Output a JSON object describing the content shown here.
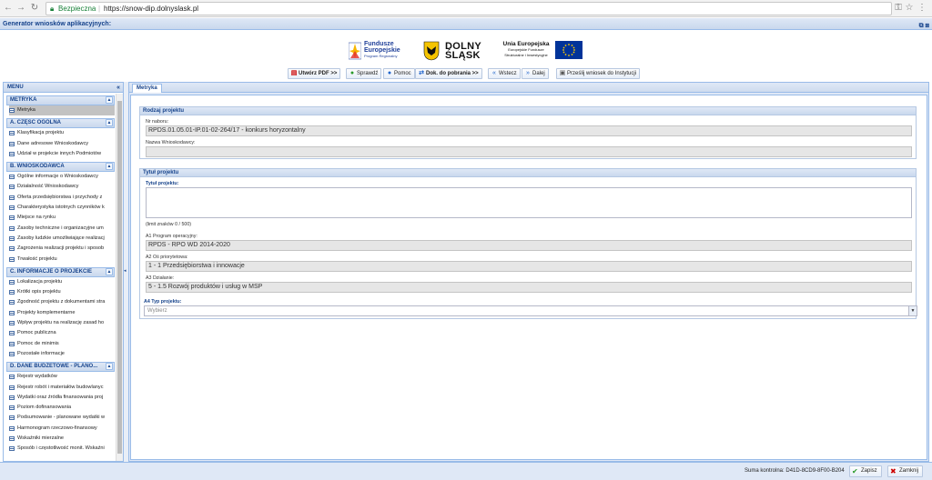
{
  "browser": {
    "secure_label": "Bezpieczna",
    "url": "https://snow-dip.dolnyslask.pl"
  },
  "app": {
    "title": "Generator wniosków aplikacyjnych:"
  },
  "logos": {
    "fe_line1": "Fundusze",
    "fe_line2": "Europejskie",
    "fe_line3": "Program Regionalny",
    "ds_line1": "DOLNY",
    "ds_line2": "ŚLĄSK",
    "ue_line1": "Unia Europejska",
    "ue_line2": "Europejskie Fundusze",
    "ue_line3": "Strukturalne i Inwestycyjne"
  },
  "toolbar": [
    {
      "label": "Utwórz PDF >>",
      "icon": "pdf-icon"
    },
    {
      "label": "Sprawdź",
      "icon": "check-icon"
    },
    {
      "label": "Pomoc",
      "icon": "help-icon"
    },
    {
      "label": "Dok. do pobrania >>",
      "icon": "download-icon"
    },
    {
      "label": "Wstecz",
      "icon": "back-icon"
    },
    {
      "label": "Dalej",
      "icon": "forward-icon"
    },
    {
      "label": "Prześlij wniosek do Instytucji",
      "icon": "send-icon"
    }
  ],
  "sidebar": {
    "title": "MENU",
    "sections": [
      {
        "title": "METRYKA",
        "items": [
          "Metryka"
        ]
      },
      {
        "title": "A. CZĘŚĆ OGÓLNA",
        "items": [
          "Klasyfikacja projektu",
          "Dane adresowe Wnioskodawcy",
          "Udział w projekcie innych Podmiotów"
        ]
      },
      {
        "title": "B. WNIOSKODAWCA",
        "items": [
          "Ogólne informacje o Wnioskodawcy",
          "Działalność Wnioskodawcy",
          "Oferta przedsiębiorstwa i przychody z",
          "Charakterystyka istotnych czynników k",
          "Miejsce na rynku",
          "Zasoby techniczne i organizacyjne um",
          "Zasoby ludzkie umożliwiające realizacj",
          "Zagrożenia realizacji projektu i sposob",
          "Trwałość projektu"
        ]
      },
      {
        "title": "C. INFORMACJE O PROJEKCIE",
        "items": [
          "Lokalizacja projektu",
          "Krótki opis projektu",
          "Zgodność projektu z dokumentami stra",
          "Projekty komplementarne",
          "Wpływ projektu na realizację zasad ho",
          "Pomoc publiczna",
          "Pomoc de minimis",
          "Pozostałe informacje"
        ]
      },
      {
        "title": "D. DANE BUDŻETOWE - PLANO...",
        "items": [
          "Rejestr wydatków",
          "Rejestr robót i materiałów budowlanyc",
          "Wydatki oraz źródła finansowania proj",
          "Poziom dofinansowania",
          "Podsumowanie - planowane wydatki w",
          "Harmonogram rzeczowo-finansowy",
          "Wskaźniki mierzalne",
          "Sposób i częstotliwość monit. Wskaźni"
        ]
      }
    ]
  },
  "main": {
    "tab": "Metryka",
    "rodzaj": {
      "title": "Rodzaj projektu",
      "nr_label": "Nr naboru:",
      "nr_value": "RPDS.01.05.01-IP.01-02-264/17 - konkurs horyzontalny",
      "nazwa_label": "Nazwa Wnioskodawcy:",
      "nazwa_value": ""
    },
    "tytul": {
      "title": "Tytuł projektu",
      "tytul_label": "Tytuł projektu:",
      "limit": "(limit znaków 0 / 500)",
      "a1_label": "A1 Program operacyjny:",
      "a1_value": "RPDS - RPO WD 2014-2020",
      "a2_label": "A2 Oś priorytetowa:",
      "a2_value": "1 - 1 Przedsiębiorstwa i innowacje",
      "a3_label": "A3 Działanie:",
      "a3_value": "5 - 1.5 Rozwój produktów i usług w MSP",
      "a4_label": "A4 Typ projektu:",
      "a4_placeholder": "Wybierz"
    }
  },
  "status": {
    "suma": "Suma kontrolna: D41D-8CD9-8F00-B204",
    "save": "Zapisz",
    "close": "Zamknij"
  }
}
